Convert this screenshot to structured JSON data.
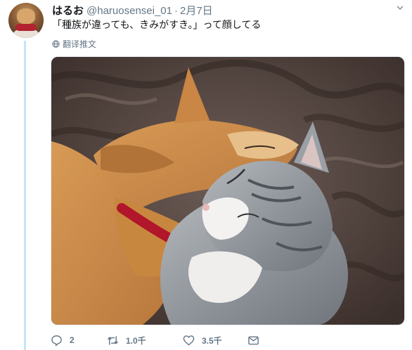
{
  "tweet": {
    "display_name": "はるお",
    "handle": "@haruosensei_01",
    "separator": "·",
    "date": "2月7日",
    "text": "「種族が違っても、きみがすき。」って顔してる",
    "translate_label": "翻译推文"
  },
  "actions": {
    "reply_count": "2",
    "retweet_count": "1.0千",
    "like_count": "3.5千"
  },
  "colors": {
    "thread_line": "#c4e4f9",
    "muted_text": "#657786",
    "dog_fur": "#c98a48",
    "cat_fur": "#9aa0a6",
    "collar": "#b1162a",
    "blanket": "#5a4a44"
  },
  "icons": [
    "caret-down-icon",
    "globe-icon",
    "reply-icon",
    "retweet-icon",
    "like-icon",
    "direct-message-icon"
  ]
}
